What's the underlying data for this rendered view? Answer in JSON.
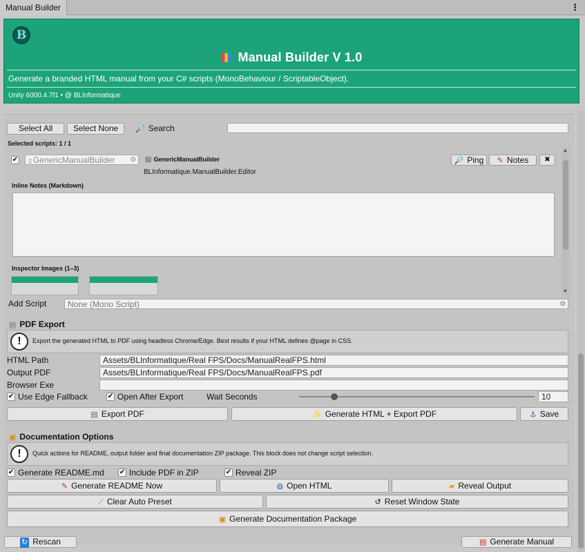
{
  "window": {
    "tab_title": "Manual Builder",
    "menu_icon": "⋮"
  },
  "header": {
    "logo_letter": "B",
    "title": "Manual Builder V 1.0",
    "subtitle": "Generate a branded HTML manual from your C# scripts (MonoBehaviour / ScriptableObject).",
    "meta": "Unity 6000.4.7f1 • @ BLInformatique",
    "accent_color": "#1da379"
  },
  "toolbar": {
    "select_all": "Select All",
    "select_none": "Select None",
    "search_label": "Search",
    "search_value": ""
  },
  "selection": {
    "count_label": "Selected scripts: 1 / 1"
  },
  "script_item": {
    "checked": true,
    "object_field": "GenericManualBuilder",
    "name": "GenericManualBuilder",
    "namespace": "BLInformatique.ManualBuilder.Editor",
    "ping_label": "Ping",
    "notes_label": "Notes",
    "remove_label": "✖",
    "inline_notes_label": "Inline Notes (Markdown)",
    "inline_notes_value": "",
    "inspector_images_label": "Inspector Images (1–3)"
  },
  "add_script": {
    "label": "Add Script",
    "value": "None (Mono Script)"
  },
  "pdf_export": {
    "section_title": "PDF Export",
    "info": "Export the generated HTML to PDF using headless Chrome/Edge. Best results if your HTML defines @page in CSS.",
    "html_path_label": "HTML Path",
    "html_path_value": "Assets/BLInformatique/Real FPS/Docs/ManualRealFPS.html",
    "output_pdf_label": "Output PDF",
    "output_pdf_value": "Assets/BLInformatique/Real FPS/Docs/ManualRealFPS.pdf",
    "browser_exe_label": "Browser Exe",
    "browser_exe_value": "",
    "use_edge_label": "Use Edge Fallback",
    "use_edge_checked": true,
    "open_after_label": "Open After Export",
    "open_after_checked": true,
    "wait_label": "Wait Seconds",
    "wait_value": "10",
    "wait_fraction": 0.15,
    "export_pdf_label": "Export PDF",
    "generate_export_label": "Generate HTML + Export PDF",
    "save_label": "Save"
  },
  "doc_options": {
    "section_title": "Documentation Options",
    "info": "Quick actions for README, output folder and final documentation ZIP package. This block does not change script selection.",
    "gen_readme_md_label": "Generate README.md",
    "gen_readme_md_checked": true,
    "include_pdf_label": "Include PDF in ZIP",
    "include_pdf_checked": true,
    "reveal_zip_label": "Reveal ZIP",
    "reveal_zip_checked": true,
    "gen_readme_now_label": "Generate README Now",
    "open_html_label": "Open HTML",
    "reveal_output_label": "Reveal Output",
    "clear_preset_label": "Clear Auto Preset",
    "reset_window_label": "Reset Window State",
    "gen_package_label": "Generate Documentation Package"
  },
  "footer": {
    "rescan_label": "Rescan",
    "generate_manual_label": "Generate Manual"
  }
}
